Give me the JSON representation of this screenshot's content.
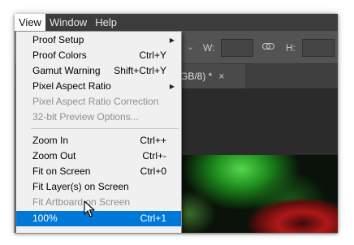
{
  "menubar": {
    "items": [
      {
        "label": "View"
      },
      {
        "label": "Window"
      },
      {
        "label": "Help"
      }
    ]
  },
  "options_bar": {
    "width_label": "W:",
    "height_label": "H:",
    "chevron": "⌄"
  },
  "document_tab": {
    "title_fragment": "GB/8) *",
    "close_glyph": "×"
  },
  "view_menu": {
    "items": [
      {
        "label": "Proof Setup",
        "shortcut": "",
        "submenu": true,
        "disabled": false
      },
      {
        "label": "Proof Colors",
        "shortcut": "Ctrl+Y",
        "submenu": false,
        "disabled": false
      },
      {
        "label": "Gamut Warning",
        "shortcut": "Shift+Ctrl+Y",
        "submenu": false,
        "disabled": false
      },
      {
        "label": "Pixel Aspect Ratio",
        "shortcut": "",
        "submenu": true,
        "disabled": false
      },
      {
        "label": "Pixel Aspect Ratio Correction",
        "shortcut": "",
        "submenu": false,
        "disabled": true
      },
      {
        "label": "32-bit Preview Options...",
        "shortcut": "",
        "submenu": false,
        "disabled": true
      },
      {
        "label": "Zoom In",
        "shortcut": "Ctrl++",
        "submenu": false,
        "disabled": false
      },
      {
        "label": "Zoom Out",
        "shortcut": "Ctrl+-",
        "submenu": false,
        "disabled": false
      },
      {
        "label": "Fit on Screen",
        "shortcut": "Ctrl+0",
        "submenu": false,
        "disabled": false
      },
      {
        "label": "Fit Layer(s) on Screen",
        "shortcut": "",
        "submenu": false,
        "disabled": false
      },
      {
        "label": "Fit Artboard on Screen",
        "shortcut": "",
        "submenu": false,
        "disabled": true
      },
      {
        "label": "100%",
        "shortcut": "Ctrl+1",
        "submenu": false,
        "disabled": false,
        "highlighted": true
      }
    ],
    "submenu_arrow": "▶"
  },
  "colors": {
    "menubar_bg": "#3c3c3c",
    "menu_bg": "#f0f0f0",
    "highlight": "#0078d7",
    "disabled_text": "#8f8f8f"
  },
  "icons": {
    "link": "link-icon",
    "cursor": "mouse-pointer-icon",
    "close": "close-icon",
    "submenu": "chevron-right-icon"
  }
}
